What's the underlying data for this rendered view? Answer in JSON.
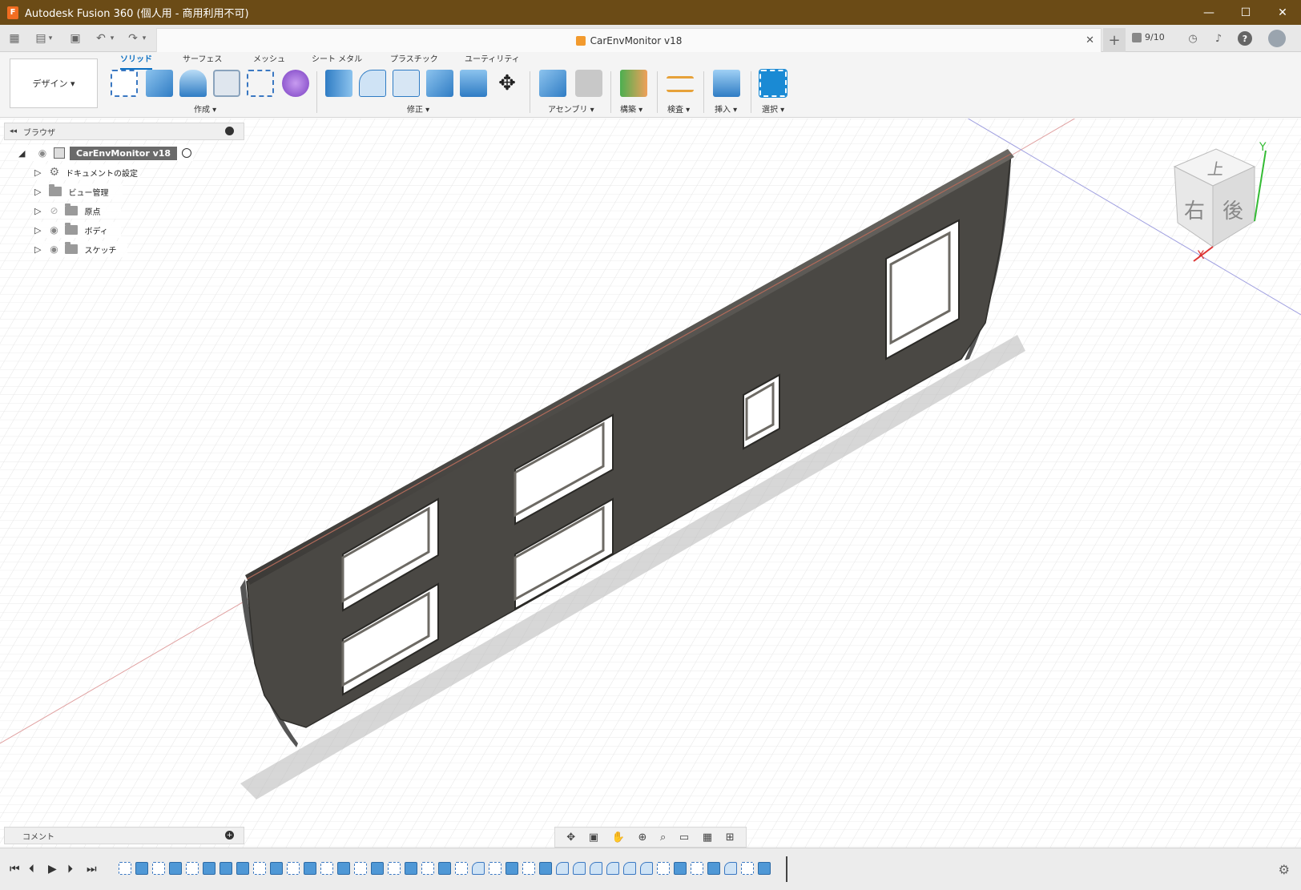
{
  "window": {
    "title": "Autodesk Fusion 360 (個人用 - 商用利用不可)",
    "app_icon": "F",
    "min_label": "—",
    "max_label": "☐",
    "close_label": "✕"
  },
  "qat": {
    "doc_title": "CarEnvMonitor v18",
    "job_status": "9/10",
    "close_tab": "✕",
    "new_tab": "+"
  },
  "ribbon": {
    "workspace": "デザイン ▾",
    "tabs": [
      "ソリッド",
      "サーフェス",
      "メッシュ",
      "シート メタル",
      "プラスチック",
      "ユーティリティ"
    ],
    "groups": [
      "作成 ▾",
      "修正 ▾",
      "アセンブリ ▾",
      "構築 ▾",
      "検査 ▾",
      "挿入 ▾",
      "選択 ▾"
    ]
  },
  "browser": {
    "header": "ブラウザ",
    "collapse_glyph": "◂◂",
    "root": "CarEnvMonitor v18",
    "items": [
      "ドキュメントの設定",
      "ビュー管理",
      "原点",
      "ボディ",
      "スケッチ"
    ]
  },
  "viewcube": {
    "top": "上",
    "right": "右",
    "back": "後",
    "axis_x": "X",
    "axis_y": "Y"
  },
  "comment": {
    "label": "コメント"
  },
  "colors": {
    "titlebar": "#6b4b16",
    "accent": "#0b6fc2",
    "body_fill": "#4a4844",
    "grid": "#e0e0e0"
  },
  "timeline": {
    "features": [
      "sketch",
      "extrude",
      "sketch",
      "extrude",
      "sketch",
      "extrude",
      "extrude",
      "extrude",
      "sketch",
      "extrude",
      "sketch",
      "extrude",
      "sketch",
      "extrude",
      "sketch",
      "extrude",
      "sketch",
      "extrude",
      "sketch",
      "extrude",
      "sketch",
      "fillet",
      "sketch",
      "extrude",
      "sketch",
      "extrude",
      "fillet",
      "fillet",
      "fillet",
      "fillet",
      "fillet",
      "fillet",
      "sketch",
      "extrude",
      "sketch",
      "extrude",
      "fillet",
      "sketch",
      "extrude"
    ]
  }
}
